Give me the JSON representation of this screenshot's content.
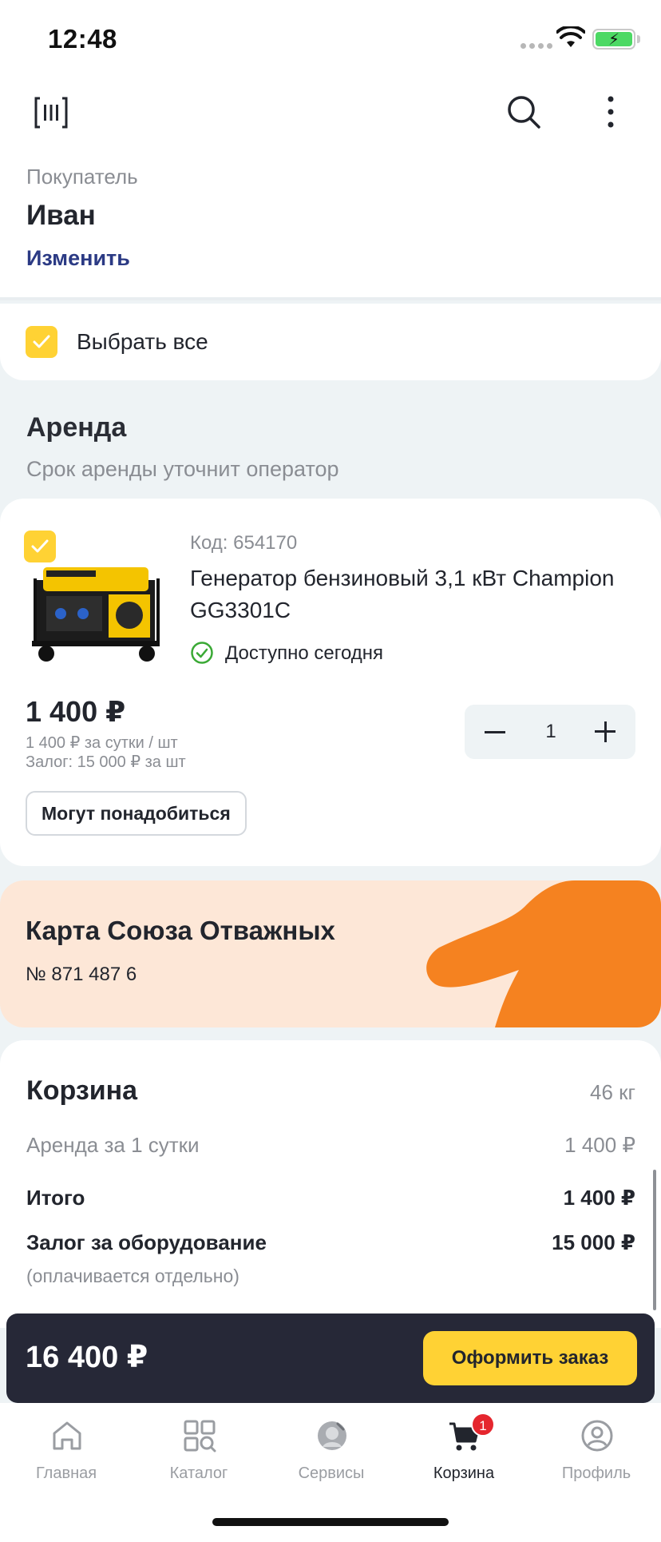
{
  "status_bar": {
    "time": "12:48"
  },
  "buyer": {
    "caption": "Покупатель",
    "name": "Иван",
    "change_label": "Изменить"
  },
  "select_all": {
    "label": "Выбрать все",
    "checked": true
  },
  "rent": {
    "title": "Аренда",
    "subtitle": "Срок аренды уточнит оператор"
  },
  "product": {
    "code": "Код: 654170",
    "title": "Генератор бензиновый 3,1 кВт Champion GG3301C",
    "availability": "Доступно сегодня",
    "price": "1 400 ₽",
    "price_per_day": "1 400 ₽ за сутки / шт",
    "deposit": "Залог: 15 000 ₽ за шт",
    "quantity": "1",
    "may_need_label": "Могут понадобиться",
    "checked": true
  },
  "loyalty_card": {
    "title": "Карта Союза Отважных",
    "number": "№ 871 487 6"
  },
  "cart_summary": {
    "title": "Корзина",
    "weight": "46 кг",
    "rent_label": "Аренда за 1 сутки",
    "rent_value": "1 400 ₽",
    "total_label": "Итого",
    "total_value": "1 400 ₽",
    "deposit_label": "Залог за оборудование",
    "deposit_value": "15 000 ₽",
    "deposit_note": "(оплачивается отдельно)"
  },
  "checkout": {
    "total": "16 400 ₽",
    "button_label": "Оформить заказ"
  },
  "tab_bar": {
    "items": [
      {
        "label": "Главная",
        "icon": "home-icon"
      },
      {
        "label": "Каталог",
        "icon": "catalog-icon"
      },
      {
        "label": "Сервисы",
        "icon": "services-icon"
      },
      {
        "label": "Корзина",
        "icon": "cart-icon",
        "active": true,
        "badge": "1"
      },
      {
        "label": "Профиль",
        "icon": "profile-icon"
      }
    ]
  },
  "colors": {
    "accent_yellow": "#ffd234",
    "link_blue": "#2b3a84",
    "loyalty_bg": "#fde7d7",
    "loyalty_orange": "#f58220",
    "checkout_bg": "#262837",
    "badge_red": "#e5262e",
    "available_green": "#3aa935"
  }
}
